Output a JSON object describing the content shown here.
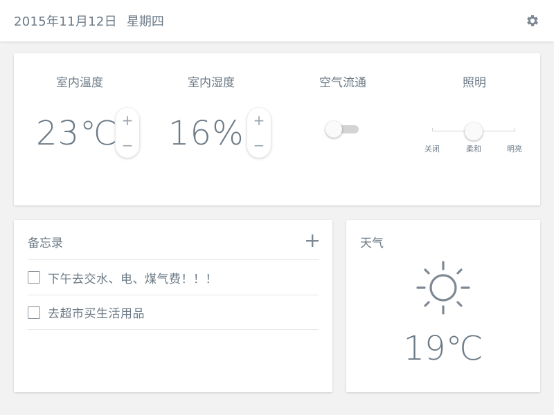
{
  "header": {
    "date": "2015年11月12日",
    "weekday": "星期四",
    "settings_icon": "gear-icon"
  },
  "controls": {
    "temperature": {
      "label": "室内温度",
      "value": "23℃",
      "plus": "+",
      "minus": "−"
    },
    "humidity": {
      "label": "室内湿度",
      "value": "16%",
      "plus": "+",
      "minus": "−"
    },
    "ventilation": {
      "label": "空气流通",
      "on": false
    },
    "lighting": {
      "label": "照明",
      "options": [
        "关闭",
        "柔和",
        "明亮"
      ],
      "selected": "柔和"
    }
  },
  "memo": {
    "title": "备忘录",
    "add_icon": "plus-icon",
    "items": [
      {
        "text": "下午去交水、电、煤气费！！！",
        "checked": false
      },
      {
        "text": "去超市买生活用品",
        "checked": false
      }
    ]
  },
  "weather": {
    "title": "天气",
    "condition_icon": "sun-icon",
    "temperature": "19℃"
  },
  "colors": {
    "text": "#6c7a86",
    "background": "#f2f2f2",
    "card": "#ffffff",
    "divider": "#e6e6e6"
  }
}
